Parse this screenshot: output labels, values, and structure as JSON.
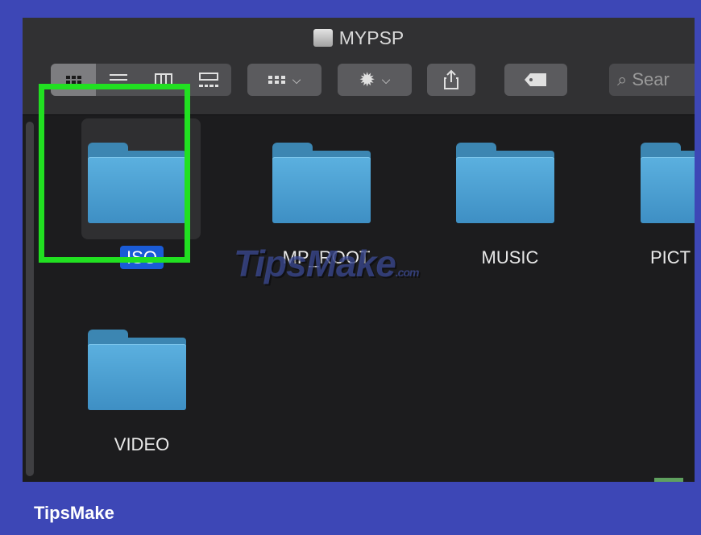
{
  "window": {
    "title": "MYPSP",
    "search_placeholder": "Sear"
  },
  "items": [
    {
      "name": "ISO",
      "selected": true
    },
    {
      "name": "MP_ROOT",
      "selected": false
    },
    {
      "name": "MUSIC",
      "selected": false
    },
    {
      "name": "PICT",
      "selected": false
    },
    {
      "name": "VIDEO",
      "selected": false
    }
  ],
  "watermark": {
    "text": "TipsMake",
    "suffix": ".com"
  },
  "footer": {
    "brand": "TipsMake"
  },
  "colors": {
    "accent_selection": "#1a5bd6",
    "highlight_box": "#21e021",
    "background": "#3d47b6",
    "folder": "#4a9fd3"
  }
}
